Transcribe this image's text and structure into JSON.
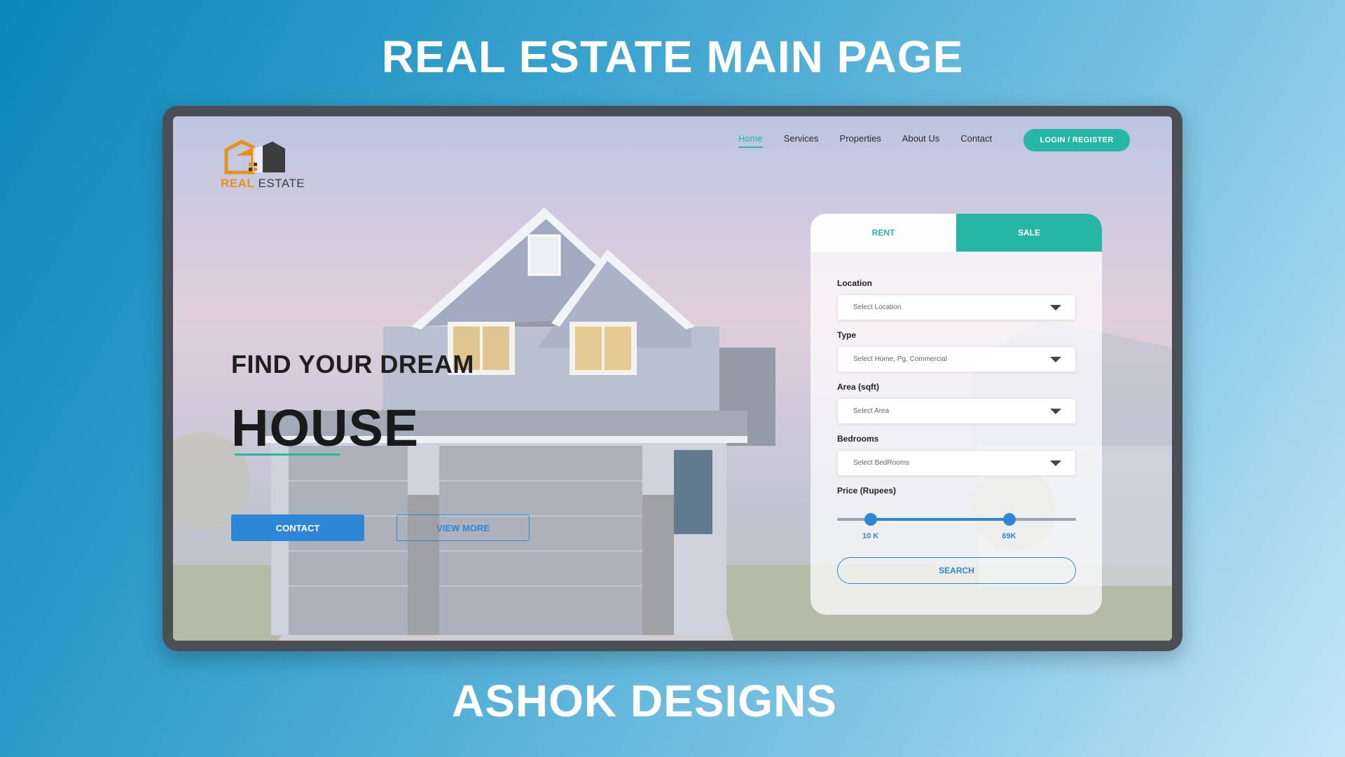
{
  "promo": {
    "title": "REAL ESTATE MAIN PAGE",
    "footer": "ASHOK DESIGNS"
  },
  "logo": {
    "word1": "REAL",
    "word2": "ESTATE"
  },
  "nav": {
    "items": [
      "Home",
      "Services",
      "Properties",
      "About Us",
      "Contact"
    ],
    "active": "Home",
    "login_label": "LOGIN / REGISTER"
  },
  "hero": {
    "line1": "FIND YOUR DREAM",
    "line2": "HOUSE",
    "contact_label": "CONTACT",
    "view_more_label": "VIEW MORE"
  },
  "search_panel": {
    "tabs": [
      "RENT",
      "SALE"
    ],
    "active_tab": "SALE",
    "fields": [
      {
        "label": "Location",
        "placeholder": "Select Location"
      },
      {
        "label": "Type",
        "placeholder": "Select Home, Pg, Commercial"
      },
      {
        "label": "Area (sqft)",
        "placeholder": "Select Area"
      },
      {
        "label": "Bedrooms",
        "placeholder": "Select  BedRooms"
      }
    ],
    "price": {
      "label": "Price (Rupees)",
      "min_label": "10 K",
      "max_label": "69K",
      "min_fraction": 0.14,
      "max_fraction": 0.72
    },
    "search_label": "SEARCH"
  },
  "colors": {
    "accent_teal": "#26b7a4",
    "accent_blue": "#2e86d6",
    "logo_orange": "#e8901e"
  }
}
